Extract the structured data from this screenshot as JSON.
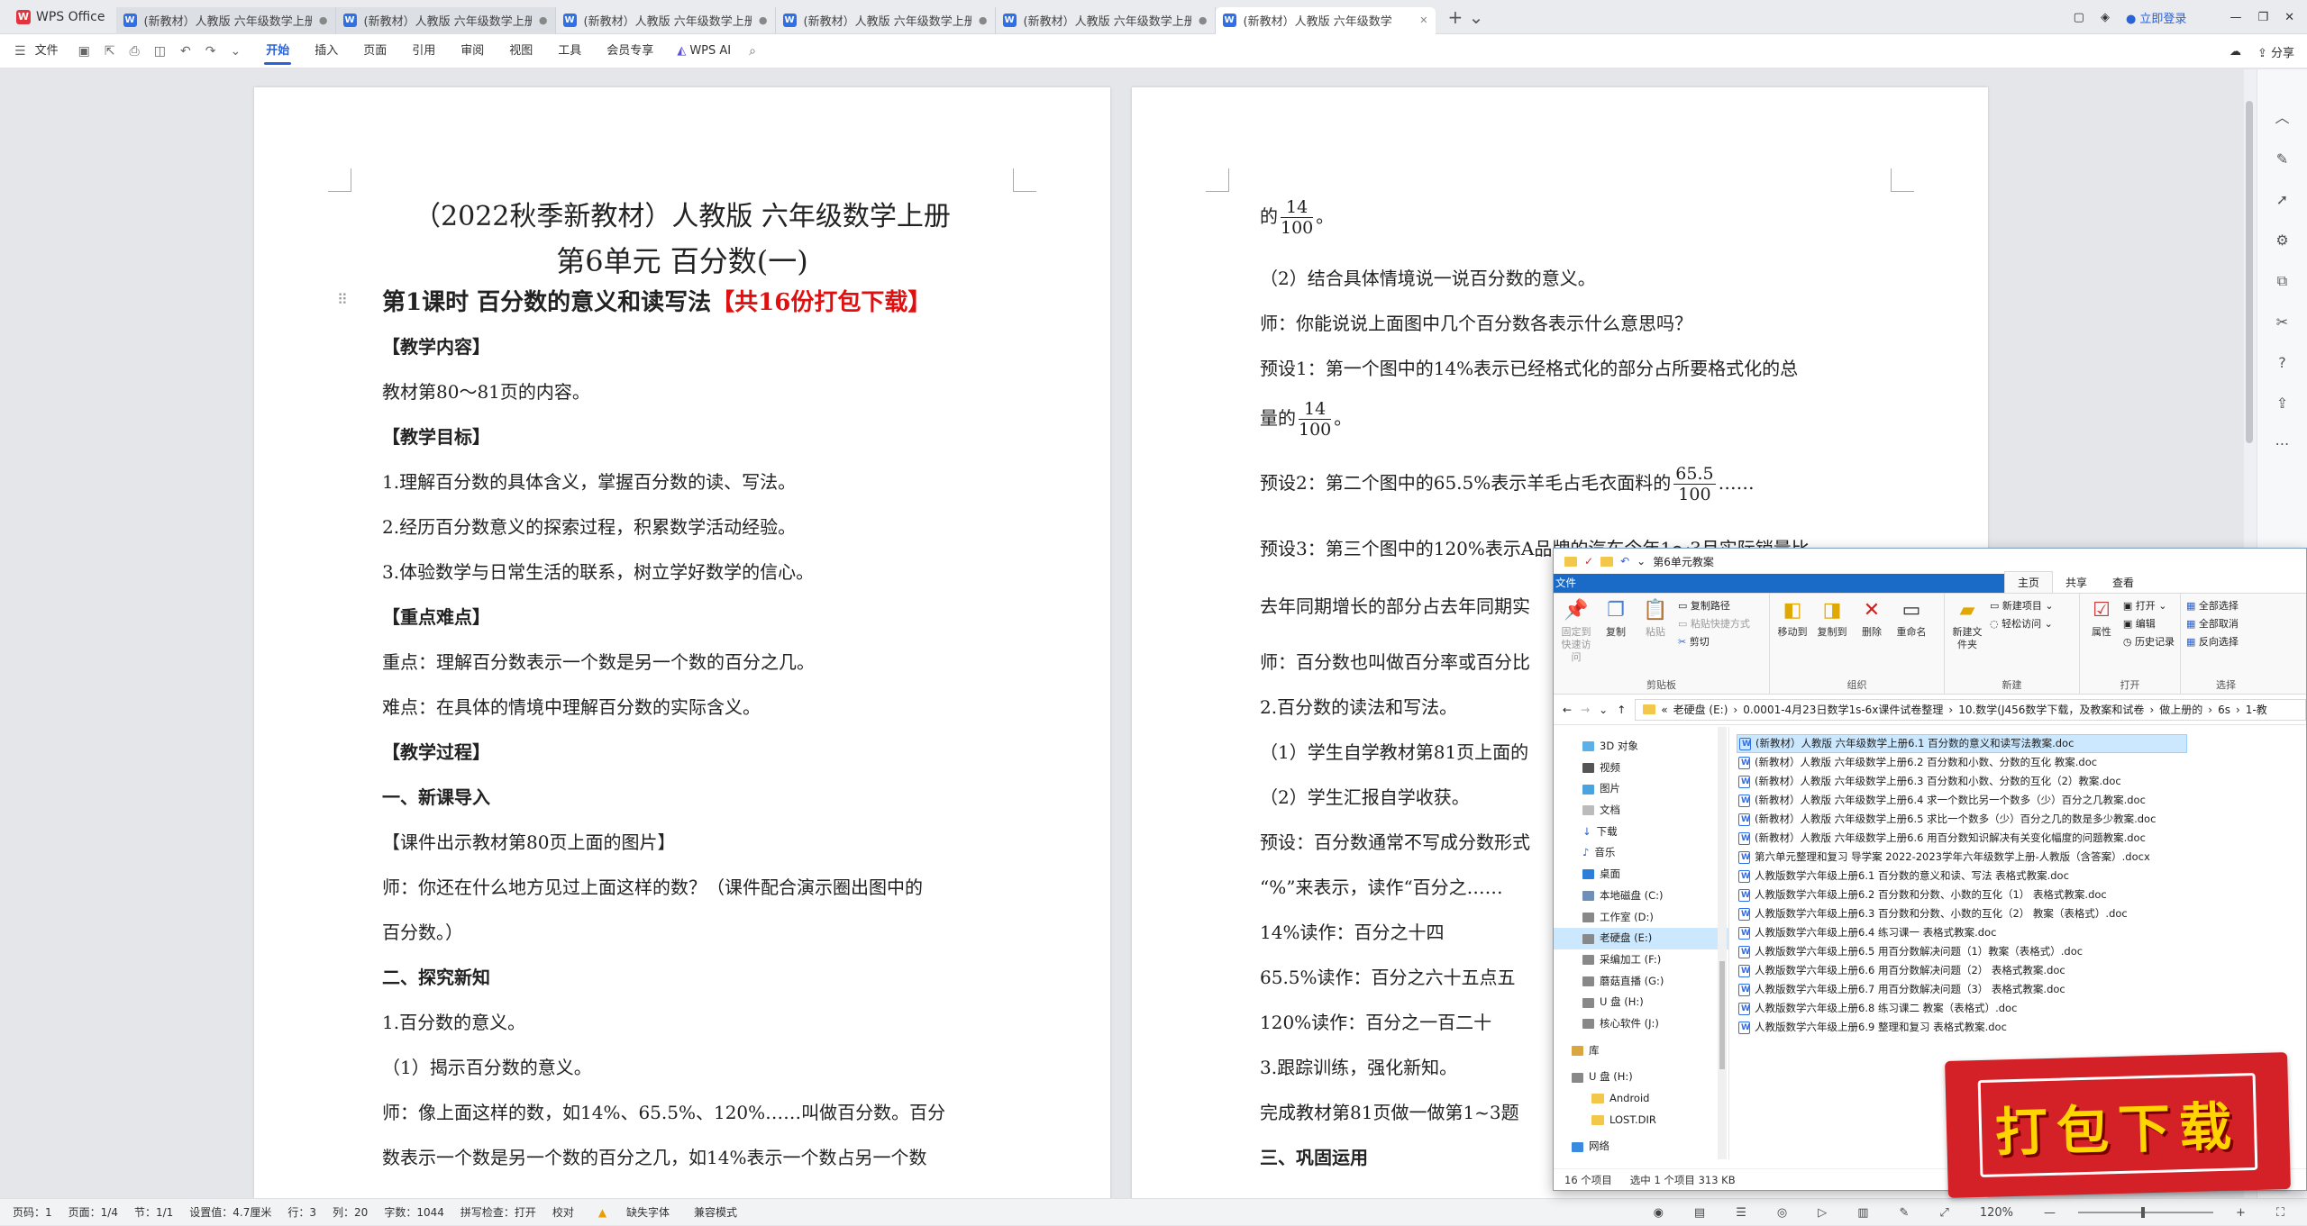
{
  "app": {
    "name": "WPS Office",
    "tabs": [
      {
        "label": "(新教材）人教版 六年级数学上册"
      },
      {
        "label": "(新教材）人教版 六年级数学上册"
      },
      {
        "label": "(新教材）人教版 六年级数学上册"
      },
      {
        "label": "(新教材）人教版 六年级数学上册"
      },
      {
        "label": "(新教材）人教版 六年级数学上册"
      },
      {
        "label": "(新教材）人教版 六年级数学"
      }
    ],
    "login_label": "立即登录",
    "share_label": "分享"
  },
  "ribbon": {
    "file_label": "文件",
    "items": [
      "开始",
      "插入",
      "页面",
      "引用",
      "审阅",
      "视图",
      "工具",
      "会员专享"
    ],
    "ai_label": "WPS AI"
  },
  "page1": {
    "title1": "（2022秋季新教材）人教版 六年级数学上册",
    "title2": "第6单元  百分数(一)",
    "lesson": "第1课时   百分数的意义和读写法",
    "lesson_red": "【共16份打包下载】",
    "lines": [
      "【教学内容】",
      "教材第80～81页的内容。",
      "【教学目标】",
      "1.理解百分数的具体含义，掌握百分数的读、写法。",
      "2.经历百分数意义的探索过程，积累数学活动经验。",
      "3.体验数学与日常生活的联系，树立学好数学的信心。",
      "【重点难点】",
      "重点：理解百分数表示一个数是另一个数的百分之几。",
      "难点：在具体的情境中理解百分数的实际含义。",
      "【教学过程】",
      "一、新课导入",
      "【课件出示教材第80页上面的图片】",
      "师：你还在什么地方见过上面这样的数？（课件配合演示圈出图中的",
      "百分数。）",
      "二、探究新知",
      "1.百分数的意义。",
      "（1）揭示百分数的意义。",
      "师：像上面这样的数，如14%、65.5%、120%……叫做百分数。百分",
      "数表示一个数是另一个数的百分之几，如14%表示一个数占另一个数"
    ]
  },
  "page2": {
    "l1_pre": "的",
    "f1_num": "14",
    "f1_den": "100",
    "l1_post": "。",
    "l2": "（2）结合具体情境说一说百分数的意义。",
    "l3": "师：你能说说上面图中几个百分数各表示什么意思吗？",
    "l4": "预设1：第一个图中的14%表示已经格式化的部分占所要格式化的总",
    "l5_pre": "量的",
    "f2_num": "14",
    "f2_den": "100",
    "l5_post": "。",
    "l6_pre": "预设2：第二个图中的65.5%表示羊毛占毛衣面料的",
    "f3_num": "65.5",
    "f3_den": "100",
    "l6_post": "……",
    "l7": "预设3：第三个图中的120%表示A品牌的汽车今年1～3月实际销量比",
    "l8": "去年同期增长的部分占去年同期实",
    "l9": "师：百分数也叫做百分率或百分比",
    "l10": "2.百分数的读法和写法。",
    "l11": "（1）学生自学教材第81页上面的",
    "l12": "（2）学生汇报自学收获。",
    "l13": "预设：百分数通常不写成分数形式",
    "l14": "“%”来表示，读作“百分之……",
    "l15": "14%读作：百分之十四",
    "l16": "65.5%读作：百分之六十五点五",
    "l17": "120%读作：百分之一百二十",
    "l18": "3.跟踪训练，强化新知。",
    "l19": "完成教材第81页做一做第1~3题",
    "l20": "三、巩固运用"
  },
  "status": {
    "items": [
      "页码：1",
      "页面：1/4",
      "节：1/1",
      "设置值：4.7厘米",
      "行：3",
      "列：20",
      "字数：1044",
      "拼写检查：打开",
      "校对",
      "缺失字体",
      "兼容模式"
    ],
    "zoom": "120%"
  },
  "explorer": {
    "title": "第6单元教案",
    "tabs": [
      "文件",
      "主页",
      "共享",
      "查看"
    ],
    "groups": {
      "clipboard": "剪贴板",
      "organize": "组织",
      "new": "新建",
      "open": "打开",
      "select": "选择"
    },
    "btn": {
      "pin": "固定到快速访问",
      "copy": "复制",
      "paste": "粘贴",
      "copy_path": "复制路径",
      "paste_shortcut": "粘贴快捷方式",
      "cut": "剪切",
      "move_to": "移动到",
      "copy_to": "复制到",
      "delete": "删除",
      "rename": "重命名",
      "new_folder": "新建文件夹",
      "new_item": "新建项目",
      "easy_access": "轻松访问",
      "properties": "属性",
      "open": "打开",
      "edit": "编辑",
      "history": "历史记录",
      "select_all": "全部选择",
      "select_none": "全部取消",
      "invert": "反向选择"
    },
    "breadcrumb": [
      "老硬盘 (E:)",
      "0.0001-4月23日数学1s-6x课件试卷整理",
      "10.数学(J456数学下载，及教案和试卷",
      "做上册的",
      "6s",
      "1-教"
    ],
    "nav": [
      "3D 对象",
      "视频",
      "图片",
      "文档",
      "下载",
      "音乐",
      "桌面",
      "本地磁盘 (C:)",
      "工作室 (D:)",
      "老硬盘 (E:)",
      "采编加工 (F:)",
      "蘑菇直播 (G:)",
      "U 盘 (H:)",
      "核心软件 (J:)",
      "库",
      "U 盘 (H:)",
      "Android",
      "LOST.DIR",
      "网络"
    ],
    "files": [
      "(新教材）人教版 六年级数学上册6.1  百分数的意义和读写法教案.doc",
      "(新教材）人教版 六年级数学上册6.2  百分数和小数、分数的互化 教案.doc",
      "(新教材）人教版 六年级数学上册6.3  百分数和小数、分数的互化（2）教案.doc",
      "(新教材）人教版 六年级数学上册6.4  求一个数比另一个数多（少）百分之几教案.doc",
      "(新教材）人教版 六年级数学上册6.5  求比一个数多（少）百分之几的数是多少教案.doc",
      "(新教材）人教版 六年级数学上册6.6  用百分数知识解决有关变化幅度的问题教案.doc",
      "第六单元整理和复习 导学案 2022-2023学年六年级数学上册-人教版（含答案）.docx",
      "人教版数学六年级上册6.1 百分数的意义和读、写法 表格式教案.doc",
      "人教版数学六年级上册6.2 百分数和分数、小数的互化（1） 表格式教案.doc",
      "人教版数学六年级上册6.3 百分数和分数、小数的互化（2） 教案（表格式）.doc",
      "人教版数学六年级上册6.4 练习课一 表格式教案.doc",
      "人教版数学六年级上册6.5 用百分数解决问题（1）教案（表格式）.doc",
      "人教版数学六年级上册6.6 用百分数解决问题（2） 表格式教案.doc",
      "人教版数学六年级上册6.7 用百分数解决问题（3） 表格式教案.doc",
      "人教版数学六年级上册6.8 练习课二 教案（表格式）.doc",
      "人教版数学六年级上册6.9 整理和复习 表格式教案.doc"
    ],
    "count": "16 个项目",
    "selected": "选中 1 个项目  313 KB"
  },
  "stamp": "打包下载"
}
